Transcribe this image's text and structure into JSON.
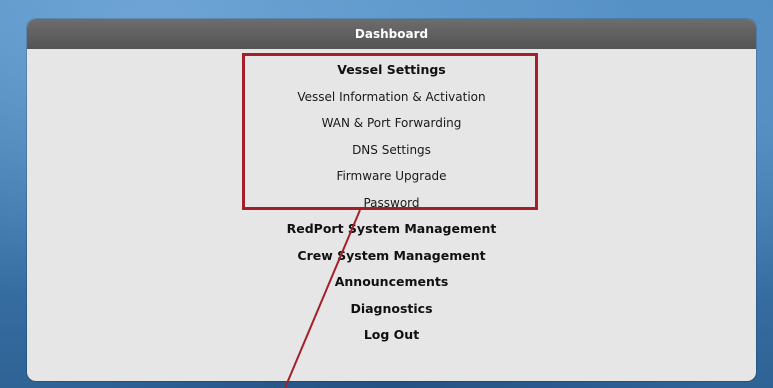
{
  "header": {
    "title": "Dashboard"
  },
  "menu": {
    "vessel_settings": "Vessel Settings",
    "vessel_info": "Vessel Information & Activation",
    "wan_port": "WAN & Port Forwarding",
    "dns": "DNS Settings",
    "firmware": "Firmware Upgrade",
    "password": "Password",
    "redport_mgmt": "RedPort System Management",
    "crew_mgmt": "Crew System Management",
    "announcements": "Announcements",
    "diagnostics": "Diagnostics",
    "logout": "Log Out"
  },
  "annotation": {
    "highlight_color": "#a3202a"
  }
}
